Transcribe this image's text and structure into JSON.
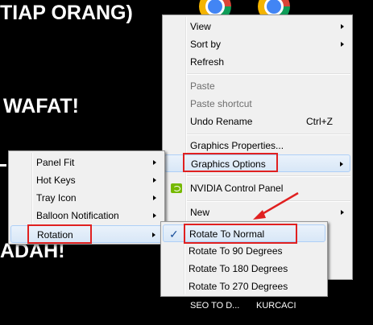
{
  "background": {
    "text_lines": [
      "TIAP ORANG)",
      "WAFAT!",
      "ADAH!"
    ],
    "desktop_labels": [
      "SEO TO D...",
      "KURCACI"
    ]
  },
  "colors": {
    "highlight_border": "#e02020",
    "menu_bg": "#f0f0f0",
    "arrow": "#e02020"
  },
  "main_menu": {
    "view": "View",
    "sort_by": "Sort by",
    "refresh": "Refresh",
    "paste": "Paste",
    "paste_shortcut": "Paste shortcut",
    "undo_rename": "Undo Rename",
    "undo_shortcut": "Ctrl+Z",
    "graphics_properties": "Graphics Properties...",
    "graphics_options": "Graphics Options",
    "nvidia": "NVIDIA Control Panel",
    "new": "New"
  },
  "graphics_options_menu": {
    "panel_fit": "Panel Fit",
    "hot_keys": "Hot Keys",
    "tray_icon": "Tray Icon",
    "balloon": "Balloon Notification",
    "rotation": "Rotation"
  },
  "rotation_menu": {
    "normal": "Rotate To Normal",
    "r90": "Rotate To 90 Degrees",
    "r180": "Rotate To 180 Degrees",
    "r270": "Rotate To 270 Degrees",
    "check_glyph": "✓"
  }
}
